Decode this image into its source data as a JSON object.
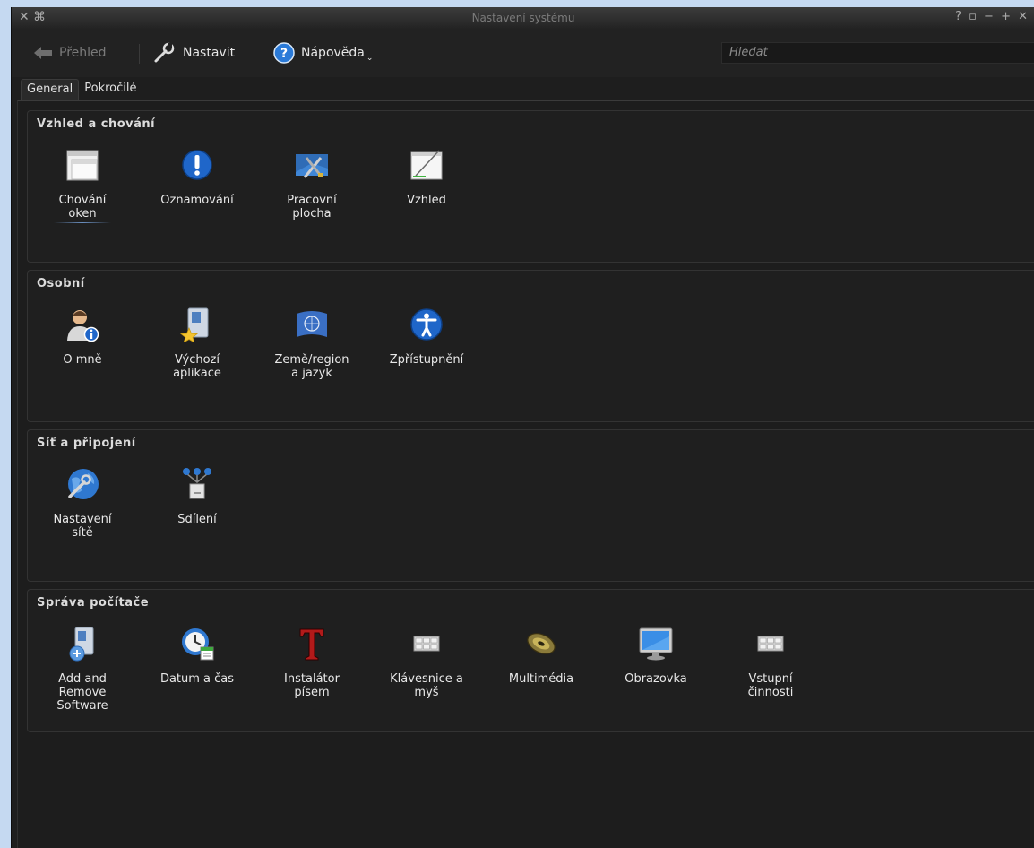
{
  "window": {
    "title": "Nastavení systému"
  },
  "toolbar": {
    "back_label": "Přehled",
    "configure_label": "Nastavit",
    "help_label": "Nápověda",
    "search_placeholder": "Hledat"
  },
  "tabs": [
    {
      "label": "General",
      "active": true
    },
    {
      "label": "Pokročilé",
      "active": false
    }
  ],
  "groups": [
    {
      "title": "Vzhled a chování",
      "items": [
        {
          "label": "Chování\noken",
          "icon": "window-behavior-icon"
        },
        {
          "label": "Oznamování",
          "icon": "notification-icon"
        },
        {
          "label": "Pracovní\nplocha",
          "icon": "desktop-tools-icon"
        },
        {
          "label": "Vzhled",
          "icon": "appearance-icon"
        }
      ]
    },
    {
      "title": "Osobní",
      "items": [
        {
          "label": "O mně",
          "icon": "user-info-icon"
        },
        {
          "label": "Výchozí\naplikace",
          "icon": "default-applications-icon"
        },
        {
          "label": "Země/region\na jazyk",
          "icon": "flag-globe-icon"
        },
        {
          "label": "Zpřístupnění",
          "icon": "accessibility-icon"
        }
      ]
    },
    {
      "title": "Síť a připojení",
      "items": [
        {
          "label": "Nastavení\nsítě",
          "icon": "network-globe-icon"
        },
        {
          "label": "Sdílení",
          "icon": "sharing-icon"
        }
      ]
    },
    {
      "title": "Správa počítače",
      "items": [
        {
          "label": "Add and\nRemove\nSoftware",
          "icon": "software-package-icon"
        },
        {
          "label": "Datum a čas",
          "icon": "clock-calendar-icon"
        },
        {
          "label": "Instalátor\npísem",
          "icon": "font-installer-icon"
        },
        {
          "label": "Klávesnice a\nmyš",
          "icon": "keyboard-icon"
        },
        {
          "label": "Multimédia",
          "icon": "speaker-icon"
        },
        {
          "label": "Obrazovka",
          "icon": "monitor-icon"
        },
        {
          "label": "Vstupní\nčinnosti",
          "icon": "input-actions-icon"
        }
      ]
    }
  ]
}
